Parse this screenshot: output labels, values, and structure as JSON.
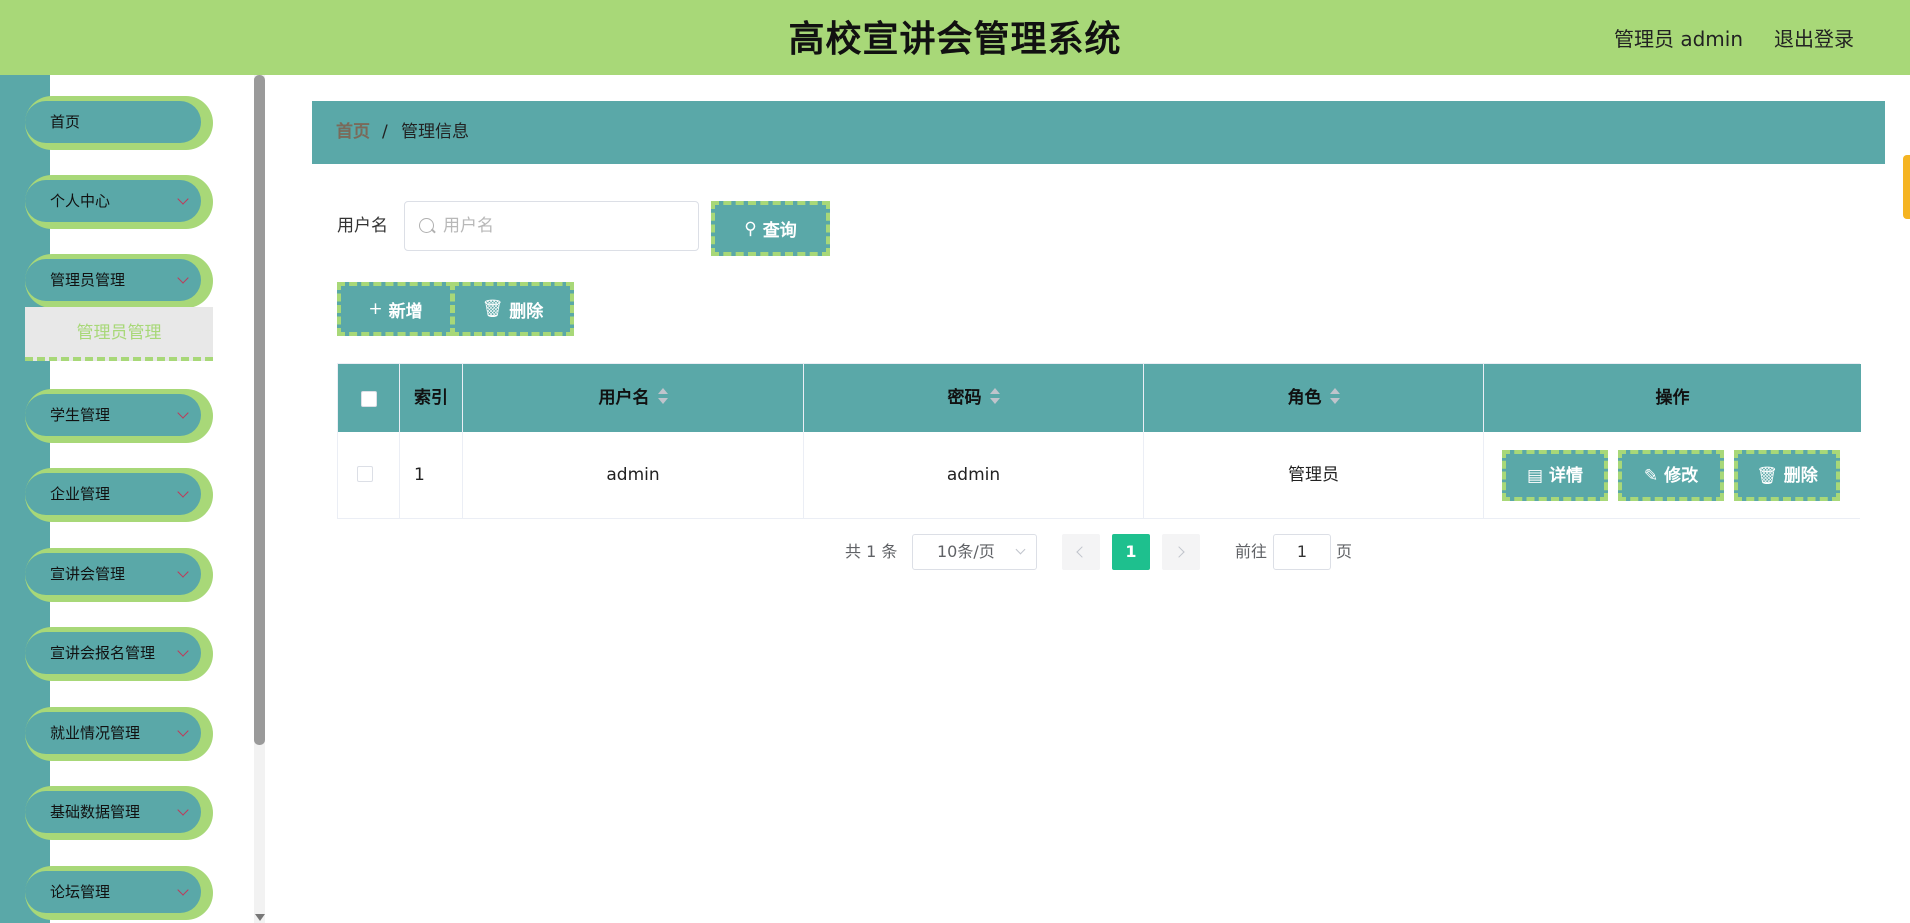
{
  "header": {
    "title": "高校宣讲会管理系统",
    "user": "管理员 admin",
    "logout": "退出登录"
  },
  "sidebar": {
    "items": [
      {
        "label": "首页",
        "has_arrow": false
      },
      {
        "label": "个人中心",
        "has_arrow": true
      },
      {
        "label": "管理员管理",
        "has_arrow": true
      },
      {
        "label": "学生管理",
        "has_arrow": true
      },
      {
        "label": "企业管理",
        "has_arrow": true
      },
      {
        "label": "宣讲会管理",
        "has_arrow": true
      },
      {
        "label": "宣讲会报名管理",
        "has_arrow": true
      },
      {
        "label": "就业情况管理",
        "has_arrow": true
      },
      {
        "label": "基础数据管理",
        "has_arrow": true
      },
      {
        "label": "论坛管理",
        "has_arrow": true
      }
    ],
    "active_submenu": "管理员管理"
  },
  "breadcrumb": {
    "home": "首页",
    "separator": "/",
    "current": "管理信息"
  },
  "search": {
    "label": "用户名",
    "placeholder": "用户名",
    "value": "",
    "button": "查询"
  },
  "actions": {
    "add": "新增",
    "delete": "删除"
  },
  "table": {
    "columns": {
      "index": "索引",
      "username": "用户名",
      "password": "密码",
      "role": "角色",
      "ops": "操作"
    },
    "rows": [
      {
        "index": "1",
        "username": "admin",
        "password": "admin",
        "role": "管理员"
      }
    ],
    "row_actions": {
      "detail": "详情",
      "edit": "修改",
      "delete": "删除"
    }
  },
  "pagination": {
    "total": "共 1 条",
    "page_size": "10条/页",
    "current": "1",
    "goto_label": "前往",
    "goto_value": "1",
    "page_suffix": "页"
  },
  "colors": {
    "header_bg": "#a8d878",
    "primary": "#5aa8a8",
    "accent_border": "#a8d878",
    "pagination_active": "#1ec08e"
  }
}
